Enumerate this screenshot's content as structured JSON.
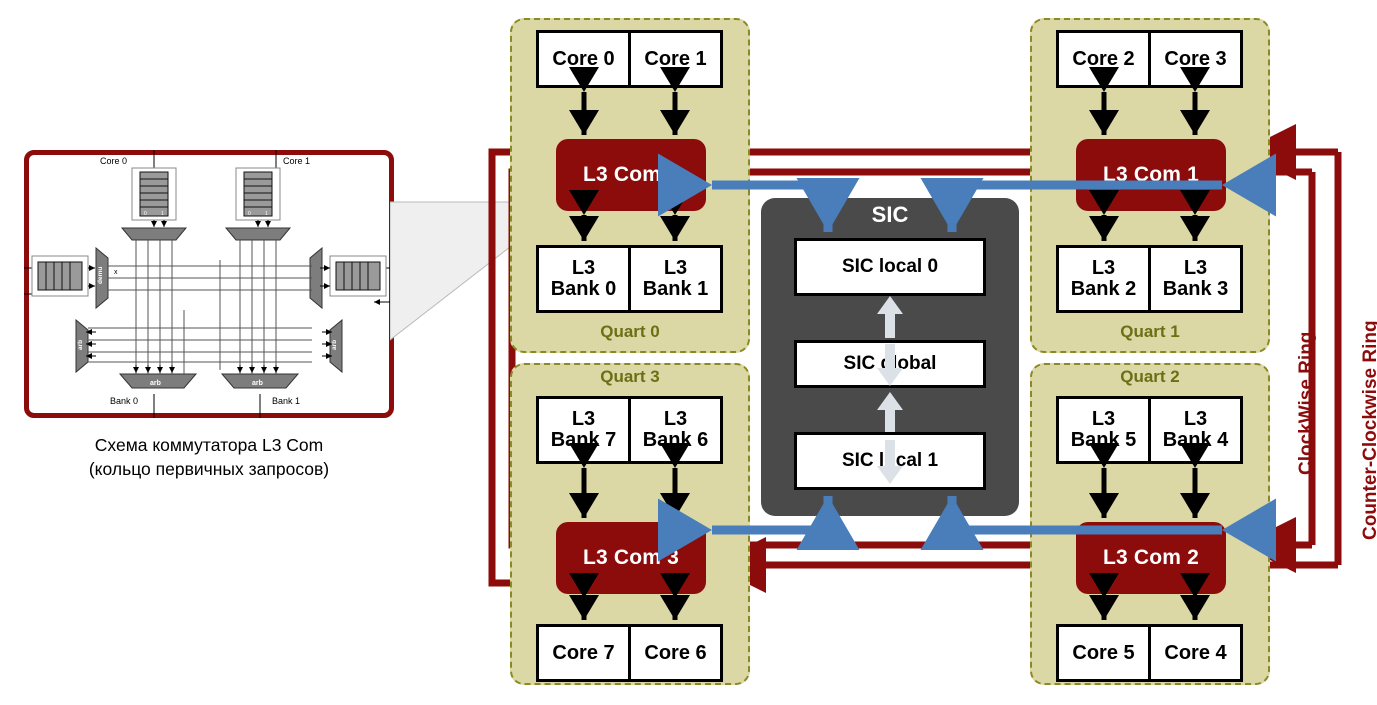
{
  "diagram": {
    "title_caption_line1": "Схема коммутатора L3 Com",
    "title_caption_line2": "(кольцо первичных запросов)",
    "colors": {
      "ring_red": "#8C0B0B",
      "quart_fill": "#DBD8A5",
      "quart_border": "#8A8A24",
      "quart_label": "#6E6E15",
      "sic_fill": "#4A4A4A",
      "sic_arrow": "#D9DEE6",
      "blue_arrow": "#4A7EBB",
      "box_fill": "#FFFFFF",
      "box_border": "#000000"
    }
  },
  "quadrants": [
    {
      "id": "quart0",
      "label": "Quart 0",
      "comm": "L3 Com 0",
      "top_boxes": [
        "Core 0",
        "Core 1"
      ],
      "bottom_boxes": [
        "L3\nBank 0",
        "L3\nBank 1"
      ],
      "bottom_lines": [
        [
          "L3",
          "Bank 0"
        ],
        [
          "L3",
          "Bank 1"
        ]
      ]
    },
    {
      "id": "quart1",
      "label": "Quart 1",
      "comm": "L3 Com 1",
      "top_boxes": [
        "Core 2",
        "Core 3"
      ],
      "bottom_lines": [
        [
          "L3",
          "Bank 2"
        ],
        [
          "L3",
          "Bank 3"
        ]
      ]
    },
    {
      "id": "quart2",
      "label": "Quart 2",
      "comm": "L3 Com 2",
      "top_lines": [
        [
          "L3",
          "Bank 5"
        ],
        [
          "L3",
          "Bank 4"
        ]
      ],
      "bottom_boxes": [
        "Core 5",
        "Core 4"
      ]
    },
    {
      "id": "quart3",
      "label": "Quart 3",
      "comm": "L3 Com 3",
      "top_lines": [
        [
          "L3",
          "Bank 7"
        ],
        [
          "L3",
          "Bank 6"
        ]
      ],
      "bottom_boxes": [
        "Core 7",
        "Core 6"
      ]
    }
  ],
  "sic": {
    "title": "SIC",
    "blocks": [
      "SIC local 0",
      "SIC global",
      "SIC local 1"
    ]
  },
  "rings": [
    {
      "id": "cw",
      "label": "ClockWise Ring"
    },
    {
      "id": "ccw",
      "label": "Counter-Clockwise Ring"
    }
  ],
  "inset": {
    "cores": [
      "Core 0",
      "Core 1"
    ],
    "banks": [
      "Bank 0",
      "Bank 1"
    ],
    "mux_labels": [
      "demu",
      "arb",
      "arb",
      "arb",
      "arb"
    ],
    "port_digits": [
      "0",
      "1"
    ],
    "cross_mark": "x"
  }
}
